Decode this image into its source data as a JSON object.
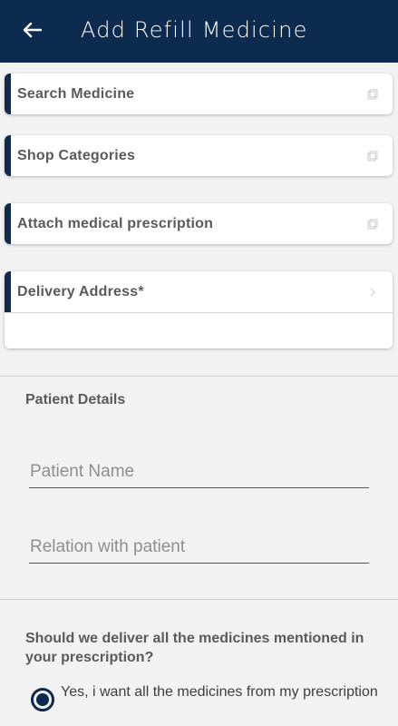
{
  "header": {
    "title": "Add Refill Medicine",
    "back_icon": "arrow-left-icon",
    "background": "#0d2a4f"
  },
  "cards": {
    "search": {
      "label": "Search Medicine",
      "icon": "open-icon"
    },
    "categories": {
      "label": "Shop Categories",
      "icon": "open-icon"
    },
    "prescription": {
      "label": "Attach medical prescription",
      "icon": "open-icon"
    },
    "delivery": {
      "label": "Delivery Address*",
      "icon": "chevron-right-icon",
      "value": ""
    }
  },
  "patient": {
    "title": "Patient Details",
    "name_placeholder": "Patient Name",
    "relation_placeholder": "Relation with patient"
  },
  "delivery_question": {
    "text": "Should we deliver all the medicines mentioned in your prescription?",
    "option_all": "Yes, i want all the medicines from my prescription",
    "option_all_selected": true
  },
  "colors": {
    "accent": "#0d2a4f",
    "background": "#f2f2f2"
  }
}
